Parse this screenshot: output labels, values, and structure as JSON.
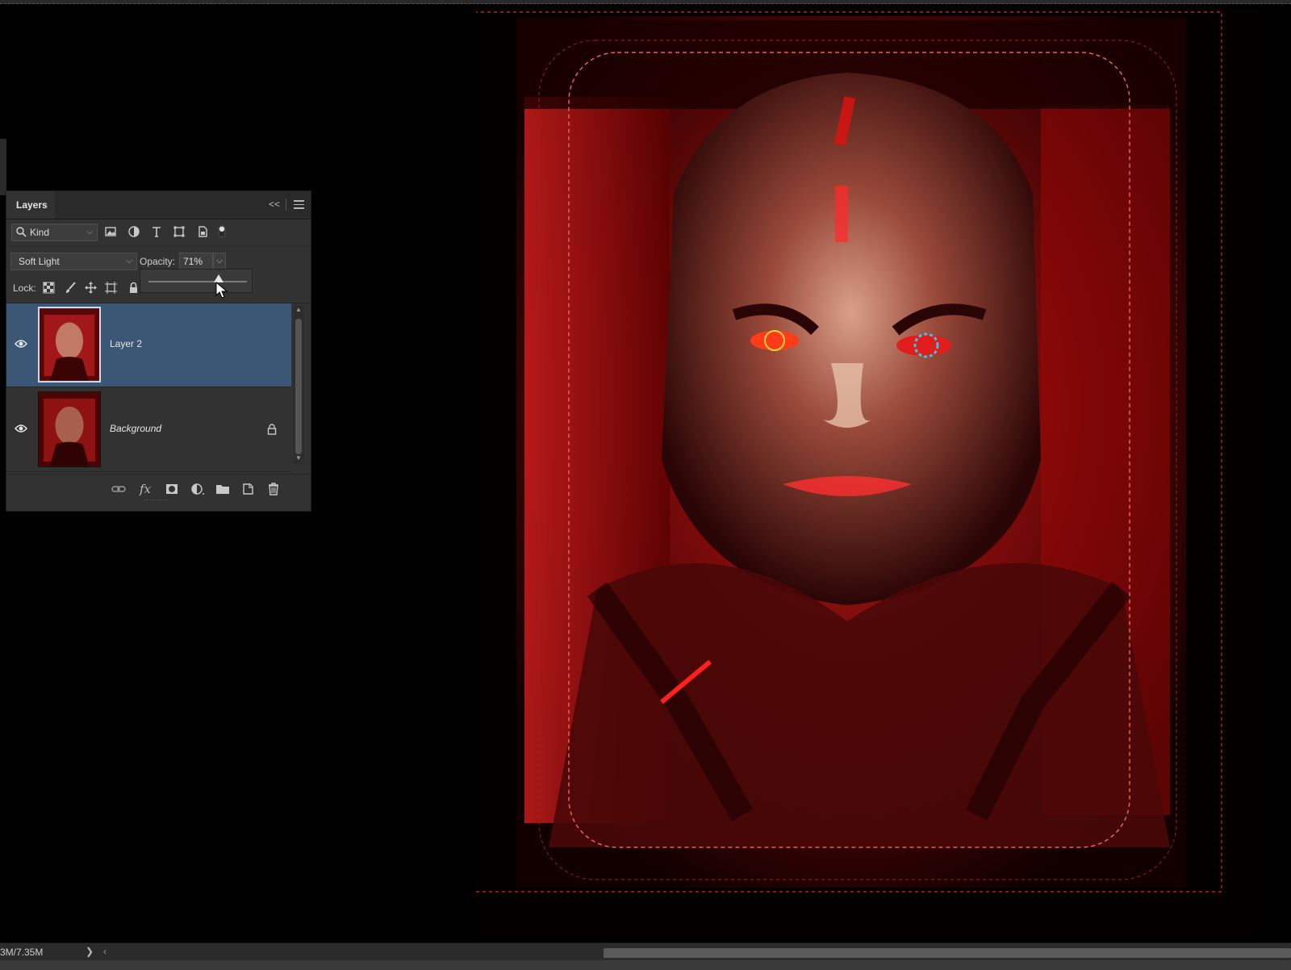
{
  "panel": {
    "tab_label": "Layers",
    "collapse_label": "<<",
    "filter": {
      "kind_label": "Kind",
      "chevron": "⌵"
    },
    "filter_icons": [
      "image-filter-icon",
      "adjustment-filter-icon",
      "type-filter-icon",
      "shape-filter-icon",
      "smart-object-filter-icon",
      "filter-toggle-icon"
    ],
    "blend_mode": "Soft Light",
    "opacity_label": "Opacity:",
    "opacity_value": "71%",
    "opacity_percent": 71,
    "lock_label": "Lock:",
    "lock_icons": [
      "lock-transparent-pixels-icon",
      "lock-image-pixels-icon",
      "lock-position-icon",
      "lock-artboard-icon",
      "lock-all-icon"
    ],
    "layers": [
      {
        "name": "Layer 2",
        "selected": true,
        "visible": true,
        "locked": false
      },
      {
        "name": "Background",
        "selected": false,
        "visible": true,
        "locked": true
      }
    ],
    "footer_icons": [
      "link-layers-icon",
      "fx-icon",
      "add-mask-icon",
      "new-adjustment-layer-icon",
      "new-group-icon",
      "new-layer-icon",
      "delete-layer-icon"
    ],
    "footer_fx_label": "fx"
  },
  "status": {
    "doc_size": "3M/7.35M",
    "arrow": "❯",
    "scroll_left": "‹"
  },
  "colors": {
    "panel_bg": "#323232",
    "selection": "#3c5675",
    "canvas_accent": "#d01818"
  }
}
